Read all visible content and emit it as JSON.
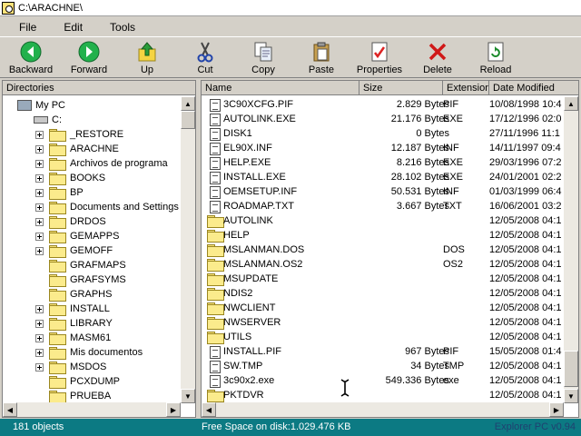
{
  "window": {
    "title": "C:\\ARACHNE\\"
  },
  "menu": [
    "File",
    "Edit",
    "Tools"
  ],
  "toolbar": [
    {
      "label": "Backward",
      "icon": "back-arrow-icon"
    },
    {
      "label": "Forward",
      "icon": "forward-arrow-icon"
    },
    {
      "label": "Up",
      "icon": "up-folder-icon"
    },
    {
      "label": "Cut",
      "icon": "scissors-icon"
    },
    {
      "label": "Copy",
      "icon": "copy-icon"
    },
    {
      "label": "Paste",
      "icon": "paste-icon"
    },
    {
      "label": "Properties",
      "icon": "properties-icon"
    },
    {
      "label": "Delete",
      "icon": "delete-x-icon"
    },
    {
      "label": "Reload",
      "icon": "reload-icon"
    }
  ],
  "directories": {
    "header": "Directories",
    "root": "My PC",
    "drive": "C:",
    "folders": [
      {
        "name": "_RESTORE",
        "expandable": true
      },
      {
        "name": "ARACHNE",
        "expandable": true
      },
      {
        "name": "Archivos de programa",
        "expandable": true
      },
      {
        "name": "BOOKS",
        "expandable": true
      },
      {
        "name": "BP",
        "expandable": true
      },
      {
        "name": "Documents and Settings",
        "expandable": true
      },
      {
        "name": "DRDOS",
        "expandable": true
      },
      {
        "name": "GEMAPPS",
        "expandable": true
      },
      {
        "name": "GEMOFF",
        "expandable": true
      },
      {
        "name": "GRAFMAPS",
        "expandable": false
      },
      {
        "name": "GRAFSYMS",
        "expandable": false
      },
      {
        "name": "GRAPHS",
        "expandable": false
      },
      {
        "name": "INSTALL",
        "expandable": true
      },
      {
        "name": "LIBRARY",
        "expandable": true
      },
      {
        "name": "MASM61",
        "expandable": true
      },
      {
        "name": "Mis documentos",
        "expandable": true
      },
      {
        "name": "MSDOS",
        "expandable": true
      },
      {
        "name": "PCXDUMP",
        "expandable": false
      },
      {
        "name": "PRUEBA",
        "expandable": false
      }
    ]
  },
  "files": {
    "columns": [
      "Name",
      "Size",
      "Extension",
      "Date Modified"
    ],
    "rows": [
      {
        "name": "3C90XCFG.PIF",
        "size": "2.829 Bytes",
        "ext": "PIF",
        "date": "10/08/1998 10:4",
        "type": "file"
      },
      {
        "name": "AUTOLINK.EXE",
        "size": "21.176 Bytes",
        "ext": "EXE",
        "date": "17/12/1996 02:0",
        "type": "file"
      },
      {
        "name": "DISK1",
        "size": "0 Bytes",
        "ext": "",
        "date": "27/11/1996 11:1",
        "type": "file"
      },
      {
        "name": "EL90X.INF",
        "size": "12.187 Bytes",
        "ext": "INF",
        "date": "14/11/1997 09:4",
        "type": "file"
      },
      {
        "name": "HELP.EXE",
        "size": "8.216 Bytes",
        "ext": "EXE",
        "date": "29/03/1996 07:2",
        "type": "file"
      },
      {
        "name": "INSTALL.EXE",
        "size": "28.102 Bytes",
        "ext": "EXE",
        "date": "24/01/2001 02:2",
        "type": "file"
      },
      {
        "name": "OEMSETUP.INF",
        "size": "50.531 Bytes",
        "ext": "INF",
        "date": "01/03/1999 06:4",
        "type": "file"
      },
      {
        "name": "ROADMAP.TXT",
        "size": "3.667 Bytes",
        "ext": "TXT",
        "date": "16/06/2001 03:2",
        "type": "file"
      },
      {
        "name": "AUTOLINK",
        "size": "",
        "ext": "",
        "date": "12/05/2008 04:1",
        "type": "folder"
      },
      {
        "name": "HELP",
        "size": "",
        "ext": "",
        "date": "12/05/2008 04:1",
        "type": "folder"
      },
      {
        "name": "MSLANMAN.DOS",
        "size": "",
        "ext": "DOS",
        "date": "12/05/2008 04:1",
        "type": "folder"
      },
      {
        "name": "MSLANMAN.OS2",
        "size": "",
        "ext": "OS2",
        "date": "12/05/2008 04:1",
        "type": "folder"
      },
      {
        "name": "MSUPDATE",
        "size": "",
        "ext": "",
        "date": "12/05/2008 04:1",
        "type": "folder"
      },
      {
        "name": "NDIS2",
        "size": "",
        "ext": "",
        "date": "12/05/2008 04:1",
        "type": "folder"
      },
      {
        "name": "NWCLIENT",
        "size": "",
        "ext": "",
        "date": "12/05/2008 04:1",
        "type": "folder"
      },
      {
        "name": "NWSERVER",
        "size": "",
        "ext": "",
        "date": "12/05/2008 04:1",
        "type": "folder"
      },
      {
        "name": "UTILS",
        "size": "",
        "ext": "",
        "date": "12/05/2008 04:1",
        "type": "folder"
      },
      {
        "name": "INSTALL.PIF",
        "size": "967 Bytes",
        "ext": "PIF",
        "date": "15/05/2008 01:4",
        "type": "file"
      },
      {
        "name": "SW.TMP",
        "size": "34 Bytes",
        "ext": "TMP",
        "date": "12/05/2008 04:1",
        "type": "file"
      },
      {
        "name": "3c90x2.exe",
        "size": "549.336 Bytes",
        "ext": "exe",
        "date": "12/05/2008 04:1",
        "type": "file"
      },
      {
        "name": "PKTDVR",
        "size": "",
        "ext": "",
        "date": "12/05/2008 04:1",
        "type": "folder"
      }
    ]
  },
  "status": {
    "objects": "181 objects",
    "free_space": "Free Space on disk:1.029.476 KB",
    "app": "Explorer PC v0.94"
  }
}
